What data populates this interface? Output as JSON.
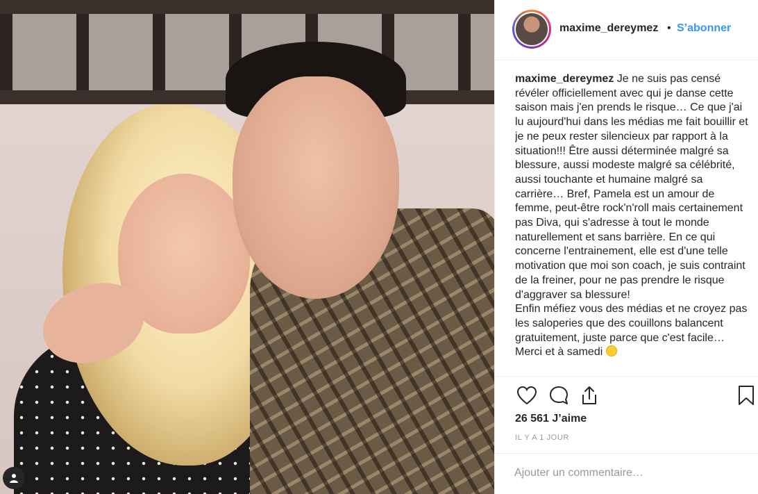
{
  "post": {
    "username": "maxime_dereymez",
    "separator": "•",
    "follow_label": "S’abonner",
    "caption_lines": [
      "Je ne suis pas censé révéler officiellement avec qui je danse cette saison mais j'en prends le risque… Ce que j'ai lu aujourd'hui dans les médias me fait bouillir et je ne peux rester silencieux par rapport à la situation!!! Être aussi déterminée malgré sa blessure, aussi modeste malgré sa célébrité, aussi touchante et humaine malgré sa carrière… Bref, Pamela est un amour de femme, peut-être rock'n'roll mais certainement pas Diva, qui s'adresse à tout le monde naturellement et sans barrière. En ce qui concerne l'entrainement, elle est d'une telle motivation que moi son coach, je suis contraint de la freiner, pour ne pas prendre le risque d'aggraver sa blessure!",
      "Enfin méfiez vous des médias et ne croyez pas les saloperies que des couillons balancent gratuitement, juste parce que c'est facile… Merci et à samedi"
    ],
    "likes": "26 561 J’aime",
    "timestamp": "IL Y A 1 JOUR",
    "comment_placeholder": "Ajouter un commentaire…"
  },
  "icons": {
    "like": "heart-icon",
    "comment": "comment-icon",
    "share": "share-icon",
    "save": "bookmark-icon",
    "tag": "user-tag-icon",
    "emoji": "winking-face-emoji"
  },
  "colors": {
    "follow": "#3897f0",
    "text": "#262626",
    "muted": "#999999",
    "divider": "#efefef"
  }
}
